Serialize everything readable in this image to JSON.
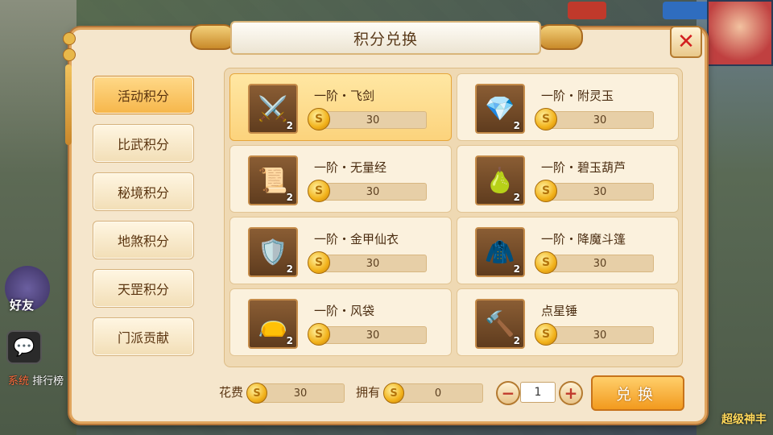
{
  "window": {
    "title": "积分兑换"
  },
  "hud": {
    "left_labels": {
      "friends": "好友",
      "chat_tag": "系统",
      "chat_text": "排行榜"
    },
    "right_label": "超级神丰"
  },
  "tabs": [
    {
      "label": "活动积分",
      "active": true
    },
    {
      "label": "比武积分",
      "active": false
    },
    {
      "label": "秘境积分",
      "active": false
    },
    {
      "label": "地煞积分",
      "active": false
    },
    {
      "label": "天罡积分",
      "active": false
    },
    {
      "label": "门派贡献",
      "active": false
    }
  ],
  "items": [
    {
      "name": "一阶・飞剑",
      "count": "2",
      "price": "30",
      "icon": "sword-icon",
      "selected": true
    },
    {
      "name": "一阶・附灵玉",
      "count": "2",
      "price": "30",
      "icon": "jade-icon",
      "selected": false
    },
    {
      "name": "一阶・无量经",
      "count": "2",
      "price": "30",
      "icon": "scroll-icon",
      "selected": false
    },
    {
      "name": "一阶・碧玉葫芦",
      "count": "2",
      "price": "30",
      "icon": "gourd-icon",
      "selected": false
    },
    {
      "name": "一阶・金甲仙衣",
      "count": "2",
      "price": "30",
      "icon": "armor-icon",
      "selected": false
    },
    {
      "name": "一阶・降魔斗篷",
      "count": "2",
      "price": "30",
      "icon": "cloak-icon",
      "selected": false
    },
    {
      "name": "一阶・风袋",
      "count": "2",
      "price": "30",
      "icon": "bag-icon",
      "selected": false
    },
    {
      "name": "点星锤",
      "count": "2",
      "price": "30",
      "icon": "hammer-icon",
      "selected": false
    }
  ],
  "footer": {
    "cost_label": "花费",
    "cost_value": "30",
    "own_label": "拥有",
    "own_value": "0",
    "quantity": "1",
    "minus_label": "−",
    "plus_label": "+",
    "exchange_label": "兑换"
  },
  "colors": {
    "accent": "#f6b64a",
    "close": "#d21f1f"
  }
}
